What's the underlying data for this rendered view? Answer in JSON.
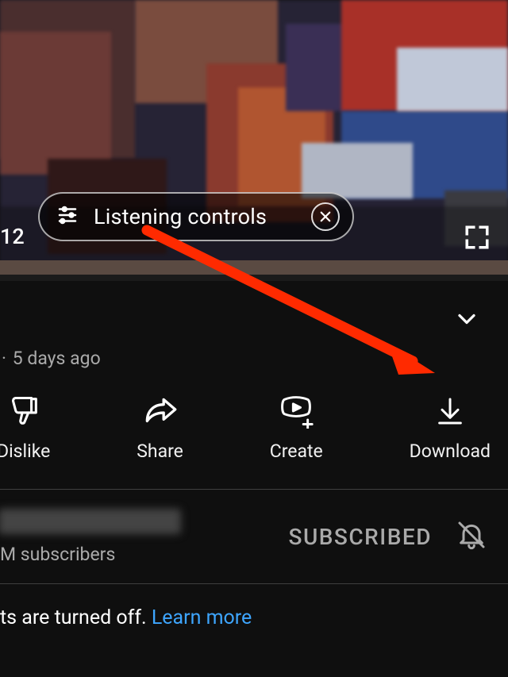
{
  "player": {
    "listening_label": "Listening controls",
    "time_left_fragment": "12"
  },
  "meta": {
    "age": "5 days ago"
  },
  "actions": {
    "dislike": "Dislike",
    "share": "Share",
    "create": "Create",
    "download": "Download"
  },
  "channel": {
    "subscribers_fragment": "M subscribers",
    "subscribed_label": "SUBSCRIBED"
  },
  "comments": {
    "text_fragment": "ts are turned off. ",
    "learn_more": "Learn more"
  }
}
